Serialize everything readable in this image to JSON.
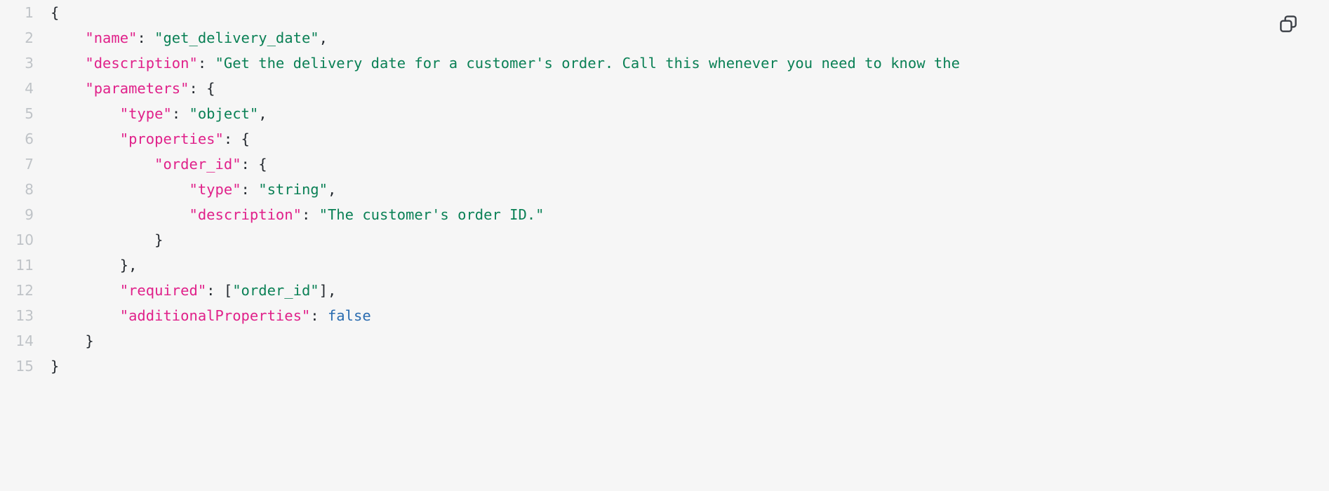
{
  "viewer": {
    "name": "json-code-block",
    "background_color": "#f6f6f6",
    "language": "json"
  },
  "toolbar": {
    "copy_button": {
      "icon": "copy-icon",
      "label": "Copy",
      "color": "#3b3f४6"
    }
  },
  "theme": {
    "background": "#f6f6f6",
    "line_number_color": "#bfc3c7",
    "punctuation_color": "#24292f",
    "key_color": "#e0218a",
    "string_color": "#0a8055",
    "boolean_color": "#2a6cb0"
  },
  "code": {
    "line_count": 15,
    "lines": [
      {
        "number": "1",
        "text": "{",
        "tokens": [
          {
            "t": "{",
            "c": "punct"
          }
        ]
      },
      {
        "number": "2",
        "text": "    \"name\": \"get_delivery_date\",",
        "tokens": [
          {
            "t": "    ",
            "c": "punct"
          },
          {
            "t": "\"name\"",
            "c": "key"
          },
          {
            "t": ": ",
            "c": "punct"
          },
          {
            "t": "\"get_delivery_date\"",
            "c": "str"
          },
          {
            "t": ",",
            "c": "punct"
          }
        ]
      },
      {
        "number": "3",
        "text": "    \"description\": \"Get the delivery date for a customer's order. Call this whenever you need to know the",
        "tokens": [
          {
            "t": "    ",
            "c": "punct"
          },
          {
            "t": "\"description\"",
            "c": "key"
          },
          {
            "t": ": ",
            "c": "punct"
          },
          {
            "t": "\"Get the delivery date for a customer's order. Call this whenever you need to know the",
            "c": "str"
          }
        ]
      },
      {
        "number": "4",
        "text": "    \"parameters\": {",
        "tokens": [
          {
            "t": "    ",
            "c": "punct"
          },
          {
            "t": "\"parameters\"",
            "c": "key"
          },
          {
            "t": ": {",
            "c": "punct"
          }
        ]
      },
      {
        "number": "5",
        "text": "        \"type\": \"object\",",
        "tokens": [
          {
            "t": "        ",
            "c": "punct"
          },
          {
            "t": "\"type\"",
            "c": "key"
          },
          {
            "t": ": ",
            "c": "punct"
          },
          {
            "t": "\"object\"",
            "c": "str"
          },
          {
            "t": ",",
            "c": "punct"
          }
        ]
      },
      {
        "number": "6",
        "text": "        \"properties\": {",
        "tokens": [
          {
            "t": "        ",
            "c": "punct"
          },
          {
            "t": "\"properties\"",
            "c": "key"
          },
          {
            "t": ": {",
            "c": "punct"
          }
        ]
      },
      {
        "number": "7",
        "text": "            \"order_id\": {",
        "tokens": [
          {
            "t": "            ",
            "c": "punct"
          },
          {
            "t": "\"order_id\"",
            "c": "key"
          },
          {
            "t": ": {",
            "c": "punct"
          }
        ]
      },
      {
        "number": "8",
        "text": "                \"type\": \"string\",",
        "tokens": [
          {
            "t": "                ",
            "c": "punct"
          },
          {
            "t": "\"type\"",
            "c": "key"
          },
          {
            "t": ": ",
            "c": "punct"
          },
          {
            "t": "\"string\"",
            "c": "str"
          },
          {
            "t": ",",
            "c": "punct"
          }
        ]
      },
      {
        "number": "9",
        "text": "                \"description\": \"The customer's order ID.\"",
        "tokens": [
          {
            "t": "                ",
            "c": "punct"
          },
          {
            "t": "\"description\"",
            "c": "key"
          },
          {
            "t": ": ",
            "c": "punct"
          },
          {
            "t": "\"The customer's order ID.\"",
            "c": "str"
          }
        ]
      },
      {
        "number": "10",
        "text": "            }",
        "tokens": [
          {
            "t": "            }",
            "c": "punct"
          }
        ]
      },
      {
        "number": "11",
        "text": "        },",
        "tokens": [
          {
            "t": "        },",
            "c": "punct"
          }
        ]
      },
      {
        "number": "12",
        "text": "        \"required\": [\"order_id\"],",
        "tokens": [
          {
            "t": "        ",
            "c": "punct"
          },
          {
            "t": "\"required\"",
            "c": "key"
          },
          {
            "t": ": [",
            "c": "punct"
          },
          {
            "t": "\"order_id\"",
            "c": "str"
          },
          {
            "t": "],",
            "c": "punct"
          }
        ]
      },
      {
        "number": "13",
        "text": "        \"additionalProperties\": false",
        "tokens": [
          {
            "t": "        ",
            "c": "punct"
          },
          {
            "t": "\"additionalProperties\"",
            "c": "key"
          },
          {
            "t": ": ",
            "c": "punct"
          },
          {
            "t": "false",
            "c": "bool"
          }
        ]
      },
      {
        "number": "14",
        "text": "    }",
        "tokens": [
          {
            "t": "    }",
            "c": "punct"
          }
        ]
      },
      {
        "number": "15",
        "text": "}",
        "tokens": [
          {
            "t": "}",
            "c": "punct"
          }
        ]
      }
    ]
  }
}
